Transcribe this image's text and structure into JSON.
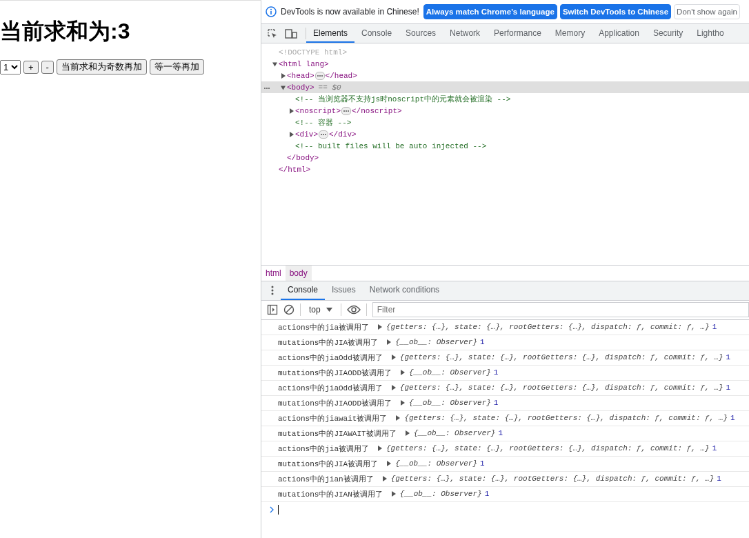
{
  "page": {
    "heading": "当前求和为:3",
    "select_value": "1",
    "buttons": [
      "+",
      "-",
      "当前求和为奇数再加",
      "等一等再加"
    ]
  },
  "devtools": {
    "banner": {
      "message": "DevTools is now available in Chinese!",
      "buttons": [
        {
          "label": "Always match Chrome's language",
          "kind": "primary"
        },
        {
          "label": "Switch DevTools to Chinese",
          "kind": "primary"
        },
        {
          "label": "Don't show again",
          "kind": "secondary"
        }
      ]
    },
    "tabs": [
      {
        "label": "Elements",
        "selected": true
      },
      {
        "label": "Console",
        "selected": false
      },
      {
        "label": "Sources",
        "selected": false
      },
      {
        "label": "Network",
        "selected": false
      },
      {
        "label": "Performance",
        "selected": false
      },
      {
        "label": "Memory",
        "selected": false
      },
      {
        "label": "Application",
        "selected": false
      },
      {
        "label": "Security",
        "selected": false
      },
      {
        "label": "Lightho",
        "selected": false
      }
    ],
    "elements_tree": [
      {
        "kind": "doctype",
        "text": "<!DOCTYPE html>",
        "selected": false
      },
      {
        "kind": "element",
        "open": "<html lang>",
        "close": "</html>",
        "expanded": true,
        "selected": false,
        "children": [
          {
            "kind": "element",
            "open": "<head>",
            "close": "</head>",
            "expanded": false,
            "selected": false
          },
          {
            "kind": "element",
            "open": "<body>",
            "close": "</body>",
            "expanded": true,
            "selected": true,
            "suffix": "== $0",
            "children": [
              {
                "kind": "comment",
                "text": "<!-- 当浏览器不支持js时noscript中的元素就会被渲染 -->",
                "selected": false
              },
              {
                "kind": "element",
                "open": "<noscript>",
                "close": "</noscript>",
                "expanded": false,
                "selected": false
              },
              {
                "kind": "comment",
                "text": "<!-- 容器 -->",
                "selected": false
              },
              {
                "kind": "element",
                "open": "<div>",
                "close": "</div>",
                "expanded": false,
                "selected": false
              },
              {
                "kind": "comment",
                "text": "<!-- built files will be auto injected -->",
                "selected": false
              }
            ]
          }
        ]
      }
    ],
    "breadcrumbs": [
      {
        "label": "html",
        "selected": false
      },
      {
        "label": "body",
        "selected": true
      }
    ],
    "drawer_tabs": [
      {
        "label": "Console",
        "selected": true
      },
      {
        "label": "Issues",
        "selected": false
      },
      {
        "label": "Network conditions",
        "selected": false
      }
    ],
    "console_toolbar": {
      "context": "top",
      "filter_placeholder": "Filter"
    },
    "console_messages": [
      {
        "message": "actions中的jia被调用了",
        "object": "{getters: {…}, state: {…}, rootGetters: {…}, dispatch: ƒ, commit: ƒ, …}",
        "value": "1"
      },
      {
        "message": "mutations中的JIA被调用了",
        "object": "{__ob__: Observer}",
        "value": "1"
      },
      {
        "message": "actions中的jiaOdd被调用了",
        "object": "{getters: {…}, state: {…}, rootGetters: {…}, dispatch: ƒ, commit: ƒ, …}",
        "value": "1"
      },
      {
        "message": "mutations中的JIAODD被调用了",
        "object": "{__ob__: Observer}",
        "value": "1"
      },
      {
        "message": "actions中的jiaOdd被调用了",
        "object": "{getters: {…}, state: {…}, rootGetters: {…}, dispatch: ƒ, commit: ƒ, …}",
        "value": "1"
      },
      {
        "message": "mutations中的JIAODD被调用了",
        "object": "{__ob__: Observer}",
        "value": "1"
      },
      {
        "message": "actions中的jiawait被调用了",
        "object": "{getters: {…}, state: {…}, rootGetters: {…}, dispatch: ƒ, commit: ƒ, …}",
        "value": "1"
      },
      {
        "message": "mutations中的JIAWAIT被调用了",
        "object": "{__ob__: Observer}",
        "value": "1"
      },
      {
        "message": "actions中的jia被调用了",
        "object": "{getters: {…}, state: {…}, rootGetters: {…}, dispatch: ƒ, commit: ƒ, …}",
        "value": "1"
      },
      {
        "message": "mutations中的JIA被调用了",
        "object": "{__ob__: Observer}",
        "value": "1"
      },
      {
        "message": "actions中的jian被调用了",
        "object": "{getters: {…}, state: {…}, rootGetters: {…}, dispatch: ƒ, commit: ƒ, …}",
        "value": "1"
      },
      {
        "message": "mutations中的JIAN被调用了",
        "object": "{__ob__: Observer}",
        "value": "1"
      }
    ]
  }
}
